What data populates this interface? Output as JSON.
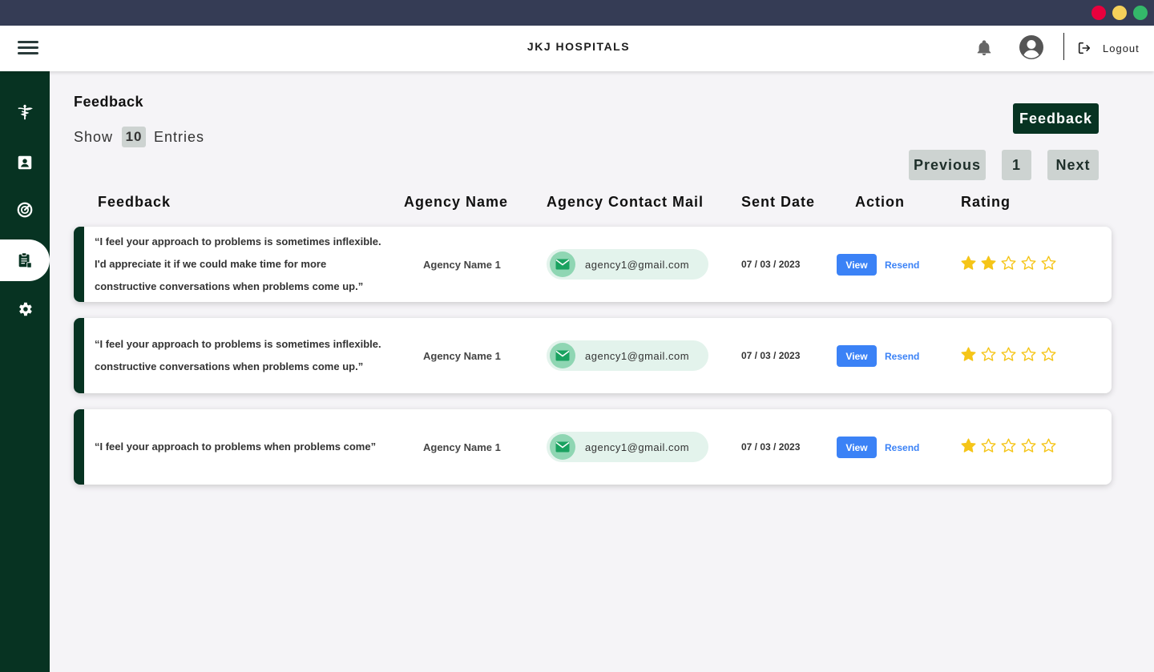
{
  "window": {
    "colors": {
      "close": "#e8003d",
      "minimize": "#f5d05a",
      "maximize": "#34b86a"
    }
  },
  "header": {
    "title": "JKJ HOSPITALS",
    "logout_label": "Logout"
  },
  "sidebar": {
    "items": [
      {
        "icon": "caduceus-icon",
        "active": false
      },
      {
        "icon": "contact-card-icon",
        "active": false
      },
      {
        "icon": "speedometer-icon",
        "active": false
      },
      {
        "icon": "clipboard-icon",
        "active": true
      },
      {
        "icon": "gear-icon",
        "active": false
      }
    ]
  },
  "page": {
    "title": "Feedback",
    "show_label": "Show",
    "entries_value": "10",
    "entries_label": "Entries",
    "feedback_button": "Feedback",
    "pager": {
      "previous": "Previous",
      "page": "1",
      "next": "Next"
    }
  },
  "table": {
    "headers": {
      "feedback": "Feedback",
      "agency_name": "Agency Name",
      "contact_mail": "Agency Contact Mail",
      "sent_date": "Sent Date",
      "action": "Action",
      "rating": "Rating"
    },
    "rows": [
      {
        "feedback": "“I feel your approach to problems is sometimes inflexible. I'd appreciate it if we could make time for more constructive conversations when problems come up.”",
        "agency": "Agency Name 1",
        "email": "agency1@gmail.com",
        "date": "07 / 03 / 2023",
        "view": "View",
        "resend": "Resend",
        "rating": 2
      },
      {
        "feedback": "“I feel your approach to problems is sometimes inflexible. constructive conversations when problems come up.”",
        "agency": "Agency Name 1",
        "email": "agency1@gmail.com",
        "date": "07 / 03 / 2023",
        "view": "View",
        "resend": "Resend",
        "rating": 1
      },
      {
        "feedback": "“I feel your approach to problems when problems come”",
        "agency": "Agency Name 1",
        "email": "agency1@gmail.com",
        "date": "07 / 03 / 2023",
        "view": "View",
        "resend": "Resend",
        "rating": 1
      }
    ],
    "max_rating": 5,
    "colors": {
      "accent": "#073322",
      "star": "#f5c518",
      "view_button": "#3b82f6"
    }
  }
}
